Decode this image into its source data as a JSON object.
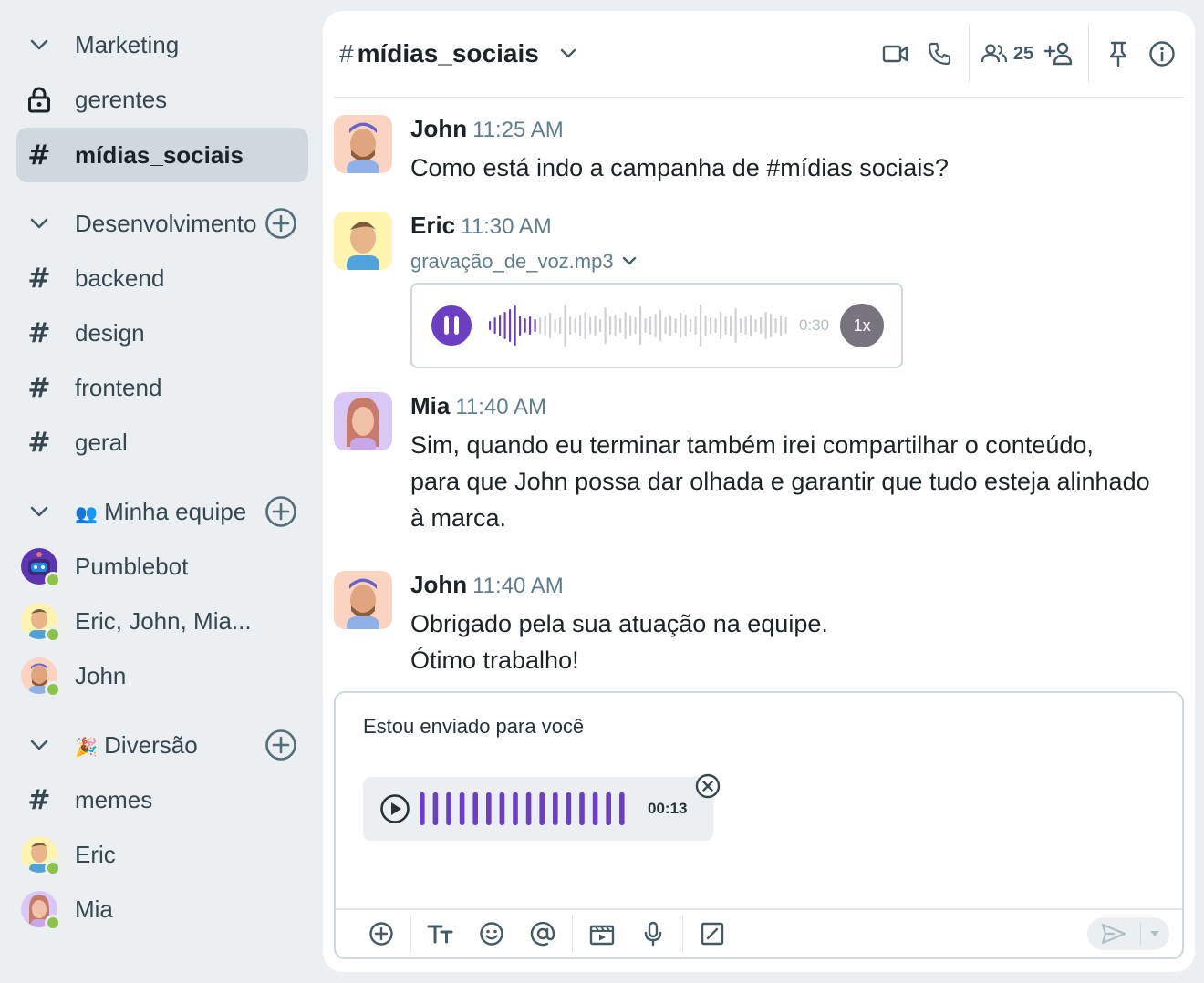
{
  "sidebar": {
    "sections": [
      {
        "label": "Marketing"
      },
      {
        "label": "Desenvolvimento"
      },
      {
        "label": "Minha equipe",
        "emoji": "👥"
      },
      {
        "label": "Diversão",
        "emoji": "🎉"
      }
    ],
    "marketing_items": [
      {
        "label": "gerentes",
        "icon": "lock-icon"
      },
      {
        "label": "mídias_sociais",
        "icon": "hash",
        "active": true
      }
    ],
    "dev_items": [
      {
        "label": "backend"
      },
      {
        "label": "design"
      },
      {
        "label": "frontend"
      },
      {
        "label": "geral"
      }
    ],
    "team_items": [
      {
        "label": "Pumblebot"
      },
      {
        "label": "Eric, John, Mia..."
      },
      {
        "label": "John"
      }
    ],
    "fun_items": [
      {
        "label": "memes"
      },
      {
        "label": "Eric"
      },
      {
        "label": "Mia"
      }
    ],
    "hash_glyph": "#"
  },
  "channel": {
    "hash": "#",
    "name": "mídias_sociais",
    "member_count": "25"
  },
  "messages": [
    {
      "author": "John",
      "time": "11:25 AM",
      "lines": [
        "Como está indo a campanha de #mídias sociais?"
      ]
    },
    {
      "author": "Eric",
      "time": "11:30 AM",
      "file": "gravação_de_voz.mp3",
      "duration": "0:30",
      "speed": "1x"
    },
    {
      "author": "Mia",
      "time": "11:40 AM",
      "lines": [
        "Sim, quando eu terminar também irei compartilhar o conteúdo,",
        "para que John possa dar olhada e garantir que tudo esteja alinhado",
        "à marca."
      ]
    },
    {
      "author": "John",
      "time": "11:40 AM",
      "lines": [
        "Obrigado pela sua atuação na equipe.",
        "Ótimo trabalho!"
      ]
    }
  ],
  "composer": {
    "text": "Estou enviado para você",
    "clip_duration": "00:13"
  },
  "colors": {
    "accent": "#6A3FC1",
    "online": "#8BC34A",
    "sidebar_bg": "#ECEFF1",
    "active_bg": "#CFD8DC"
  }
}
